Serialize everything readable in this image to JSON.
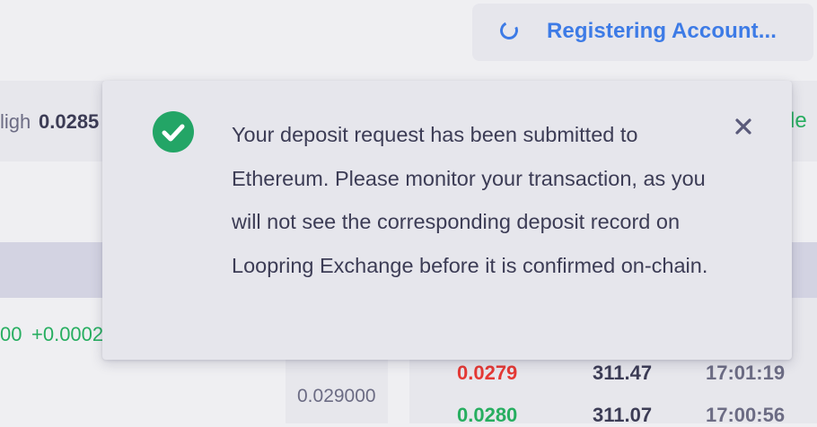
{
  "status": {
    "registering_label": "Registering Account...",
    "spinner_icon": "spinner-icon",
    "accent_color": "#3d7be6"
  },
  "ticker": {
    "high_label": "ligh",
    "high_value": "0.0285",
    "right_fragment": "le"
  },
  "market_row": {
    "price_fragment": "00",
    "change_fragment": "+0.0002"
  },
  "depth": {
    "price": "0.029000"
  },
  "trades": [
    {
      "price": "0.0279",
      "amount": "311.47",
      "time": "17:01:19",
      "side": "sell"
    },
    {
      "price": "0.0280",
      "amount": "311.07",
      "time": "17:00:56",
      "side": "buy"
    }
  ],
  "toast": {
    "icon": "check-circle-icon",
    "close_icon": "close-icon",
    "message": "Your deposit request has been submitted to Ethereum. Please monitor your transaction, as you will not see the corresponding deposit record on Loopring Exchange before it is confirmed on-chain.",
    "success_color": "#23a566"
  },
  "colors": {
    "up": "#27ae60",
    "down": "#e53935",
    "text": "#3c3c55",
    "muted": "#6c6c84"
  }
}
